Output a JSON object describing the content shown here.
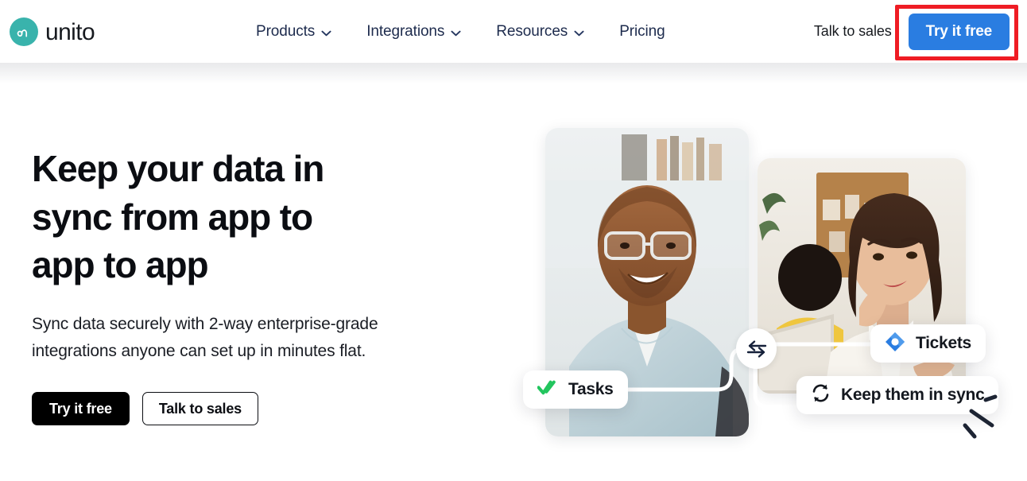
{
  "brand": {
    "name": "unito",
    "mark_icon": "unito-wave-logo-icon",
    "mark_color": "#39b3ac"
  },
  "header": {
    "nav_items": [
      {
        "label": "Products",
        "icon": "chevron-down-icon",
        "has_menu": true
      },
      {
        "label": "Integrations",
        "icon": "chevron-down-icon",
        "has_menu": true
      },
      {
        "label": "Resources",
        "icon": "chevron-down-icon",
        "has_menu": true
      },
      {
        "label": "Pricing",
        "icon": "",
        "has_menu": false
      }
    ],
    "talk_to_sales": "Talk to sales",
    "try_it_free": "Try it free",
    "cta_color": "#2a7de1"
  },
  "annotation": {
    "target": "Try it free",
    "color": "#ef1c24"
  },
  "hero": {
    "headline": "Keep your data in sync from app to app to app",
    "subheading": "Sync data securely with 2-way enterprise-grade integrations anyone can set up in minutes flat.",
    "primary_cta": "Try it free",
    "secondary_cta": "Talk to sales"
  },
  "artwork": {
    "photo_left_alt": "Smiling man with glasses in light blue shirt",
    "photo_right_alt": "Woman with dark hair in white jacket at a laptop",
    "sync_node_icon": "two-way-arrows-icon",
    "badges": [
      {
        "label": "Tasks",
        "icon": "green-double-check-icon",
        "icon_color": "#22c55e"
      },
      {
        "label": "Tickets",
        "icon": "jira-diamond-icon",
        "icon_color": "#2a7de1"
      },
      {
        "label": "Keep them in sync",
        "icon": "sync-refresh-icon",
        "icon_color": "#14181f"
      }
    ],
    "sparkle_icon": "sparkle-lines-icon"
  }
}
